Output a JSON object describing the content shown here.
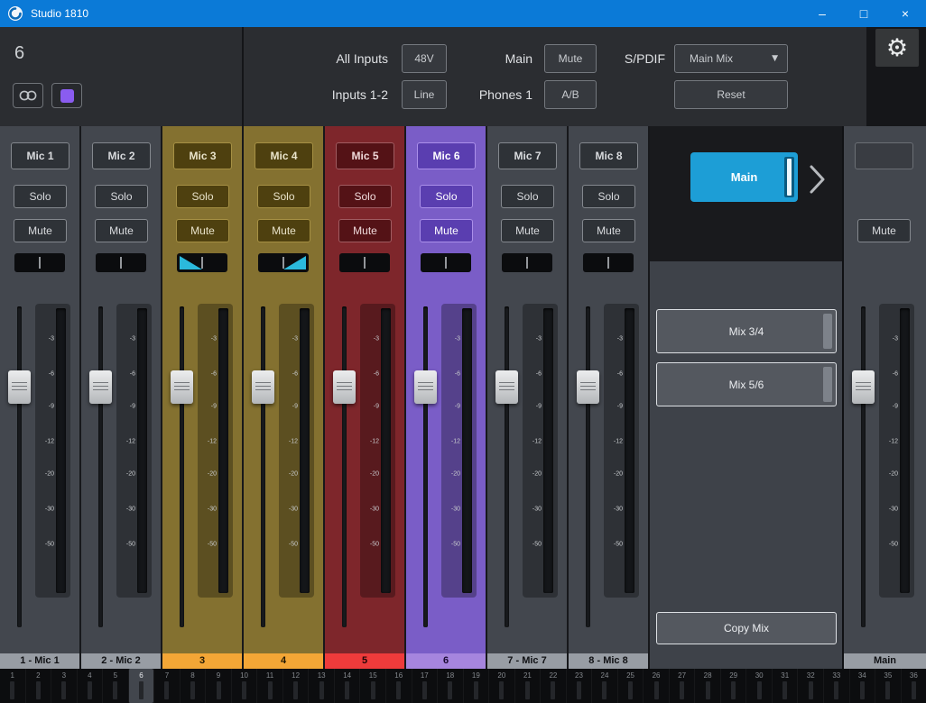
{
  "colors": {
    "titlebar": "#0b7ad7",
    "accent_teal": "#1d9ed6",
    "channel_swatch": "#8a5cf0",
    "pan_wedge": "#2bb9dc"
  },
  "icons": {
    "gear": "⚙",
    "dropdown_arrow": "▼",
    "minimize": "–",
    "maximize": "□",
    "close": "×"
  },
  "titlebar": {
    "title": "Studio 1810"
  },
  "header": {
    "selected_channel": "6",
    "rows": {
      "all_inputs_label": "All Inputs",
      "phantom_button": "48V",
      "inputs_12_label": "Inputs 1-2",
      "line_button": "Line",
      "main_label": "Main",
      "main_mute_button": "Mute",
      "phones_label": "Phones 1",
      "ab_button": "A/B",
      "spdif_label": "S/PDIF",
      "spdif_selected": "Main Mix",
      "reset_button": "Reset"
    }
  },
  "meter_scale": [
    "-3",
    "-6",
    "-9",
    "-12",
    "-20",
    "-30",
    "-50"
  ],
  "channels": [
    {
      "name": "Mic 1",
      "solo": "Solo",
      "mute": "Mute",
      "pan": "center",
      "bottom_label": "1 - Mic 1",
      "colors": {
        "strip": "#43474e",
        "btn_bg": "#2e3237",
        "btn_border": "#84888e",
        "btn_fg": "#d9dbde",
        "label_bg": "#989da4",
        "label_fg": "#101114"
      }
    },
    {
      "name": "Mic 2",
      "solo": "Solo",
      "mute": "Mute",
      "pan": "center",
      "bottom_label": "2 - Mic 2",
      "colors": {
        "strip": "#43474e",
        "btn_bg": "#2e3237",
        "btn_border": "#84888e",
        "btn_fg": "#d9dbde",
        "label_bg": "#989da4",
        "label_fg": "#101114"
      }
    },
    {
      "name": "Mic 3",
      "solo": "Solo",
      "mute": "Mute",
      "pan": "left",
      "bottom_label": "3",
      "colors": {
        "strip": "#847130",
        "btn_bg": "#4e400f",
        "btn_border": "#a69044",
        "btn_fg": "#e9e3ca",
        "label_bg": "#f3a636",
        "label_fg": "#201804"
      }
    },
    {
      "name": "Mic 4",
      "solo": "Solo",
      "mute": "Mute",
      "pan": "right",
      "bottom_label": "4",
      "colors": {
        "strip": "#847130",
        "btn_bg": "#4e400f",
        "btn_border": "#a69044",
        "btn_fg": "#e9e3ca",
        "label_bg": "#f3a636",
        "label_fg": "#201804"
      }
    },
    {
      "name": "Mic 5",
      "solo": "Solo",
      "mute": "Mute",
      "pan": "center",
      "bottom_label": "5",
      "colors": {
        "strip": "#7e262b",
        "btn_bg": "#541216",
        "btn_border": "#a05c61",
        "btn_fg": "#efd9da",
        "label_bg": "#ee3b3b",
        "label_fg": "#220505"
      }
    },
    {
      "name": "Mic 6",
      "solo": "Solo",
      "mute": "Mute",
      "pan": "center",
      "bottom_label": "6",
      "colors": {
        "strip": "#7a5dc7",
        "btn_bg": "#5a3eb0",
        "btn_border": "#ab90ea",
        "btn_fg": "#ffffff",
        "label_bg": "#a685de",
        "label_fg": "#190a31"
      }
    },
    {
      "name": "Mic 7",
      "solo": "Solo",
      "mute": "Mute",
      "pan": "center",
      "bottom_label": "7 - Mic 7",
      "colors": {
        "strip": "#43474e",
        "btn_bg": "#2e3237",
        "btn_border": "#84888e",
        "btn_fg": "#d9dbde",
        "label_bg": "#989da4",
        "label_fg": "#101114"
      }
    },
    {
      "name": "Mic 8",
      "solo": "Solo",
      "mute": "Mute",
      "pan": "center",
      "bottom_label": "8 - Mic 8",
      "colors": {
        "strip": "#43474e",
        "btn_bg": "#2e3237",
        "btn_border": "#84888e",
        "btn_fg": "#d9dbde",
        "label_bg": "#989da4",
        "label_fg": "#101114"
      }
    }
  ],
  "main_strip": {
    "name": "",
    "mute": "Mute",
    "bottom_label": "Main",
    "colors": {
      "strip": "#43474e",
      "btn_bg": "#2e3237",
      "btn_border": "#84888e",
      "btn_fg": "#d9dbde",
      "label_bg": "#989da4",
      "label_fg": "#101114"
    }
  },
  "mix_panel": {
    "main_mix": "Main",
    "mixes": [
      "Mix 3/4",
      "Mix 5/6"
    ],
    "copy_button": "Copy Mix"
  },
  "bottom_meters": {
    "selected": "6",
    "numbers": [
      "1",
      "2",
      "3",
      "4",
      "5",
      "6",
      "7",
      "8",
      "9",
      "10",
      "11",
      "12",
      "13",
      "14",
      "15",
      "16",
      "17",
      "18",
      "19",
      "20",
      "21",
      "22",
      "23",
      "24",
      "25",
      "26",
      "27",
      "28",
      "29",
      "30",
      "31",
      "32",
      "33",
      "34",
      "35",
      "36"
    ]
  }
}
